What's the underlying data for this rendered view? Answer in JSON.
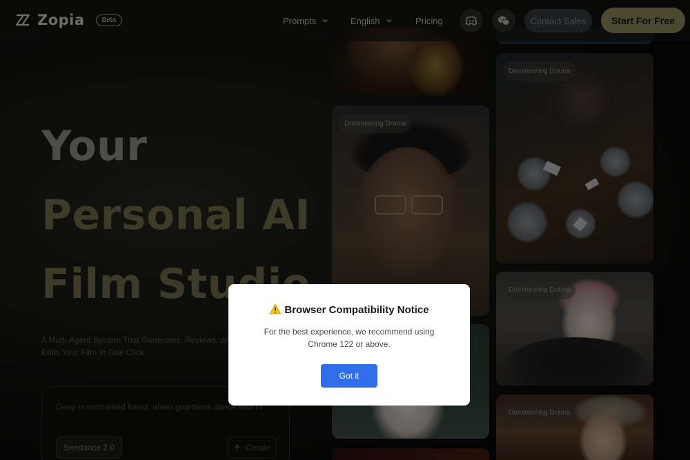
{
  "header": {
    "logo_text": "Zopia",
    "beta_badge": "Beta",
    "nav": [
      {
        "label": "Prompts"
      },
      {
        "label": "English"
      },
      {
        "label": "Pricing"
      }
    ],
    "contact_sales": "Contact Sales",
    "start_free": "Start For Free"
  },
  "hero": {
    "title_line1": "Your",
    "title_line2": "Personal AI",
    "title_line3": "Film Studio",
    "subtitle": "A Multi-Agent System That Generates, Reviews, and Edits Your Film In One Click."
  },
  "prompt": {
    "text": "Deep in enchanted forest, elven guardians dance with ma",
    "model": "Seedance 2.0",
    "create_label": "Create"
  },
  "gallery": {
    "label": "Domineering Drama"
  },
  "modal": {
    "title": "Browser Compatibility Notice",
    "message": "For the best experience, we recommend using Chrome 122 or above.",
    "button": "Got it"
  },
  "colors": {
    "accent": "#8b8658",
    "title_gold": "#706b47",
    "primary_blue": "#2f6ee8"
  }
}
